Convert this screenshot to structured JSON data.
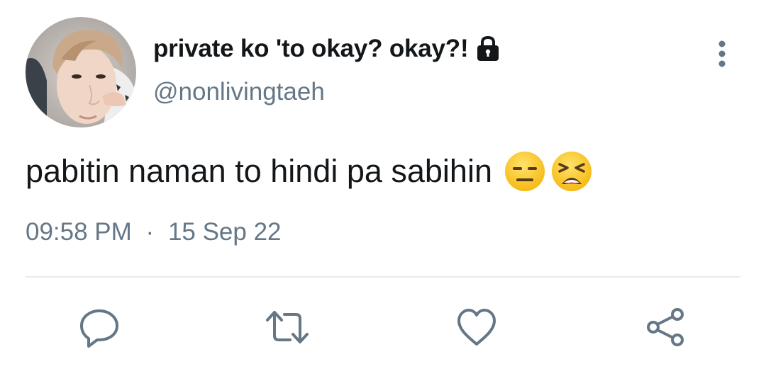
{
  "tweet": {
    "author": {
      "display_name": "private ko 'to okay? okay?!",
      "handle": "@nonlivingtaeh",
      "avatar_icon": "profile-photo",
      "protected_icon": "lock-icon"
    },
    "text": "pabitin naman to hindi pa sabihin",
    "emojis": [
      "expressionless-face-emoji",
      "tired-face-emoji"
    ],
    "time": "09:58 PM",
    "separator": "·",
    "date": "15 Sep 22"
  },
  "actions": {
    "reply_icon": "reply-icon",
    "retweet_icon": "retweet-icon",
    "like_icon": "heart-icon",
    "share_icon": "share-icon",
    "more_icon": "more-vertical-icon"
  },
  "colors": {
    "text_primary": "#14171a",
    "text_secondary": "#657786",
    "divider": "#e6ecf0",
    "emoji_yellow": "#fcc21b"
  }
}
